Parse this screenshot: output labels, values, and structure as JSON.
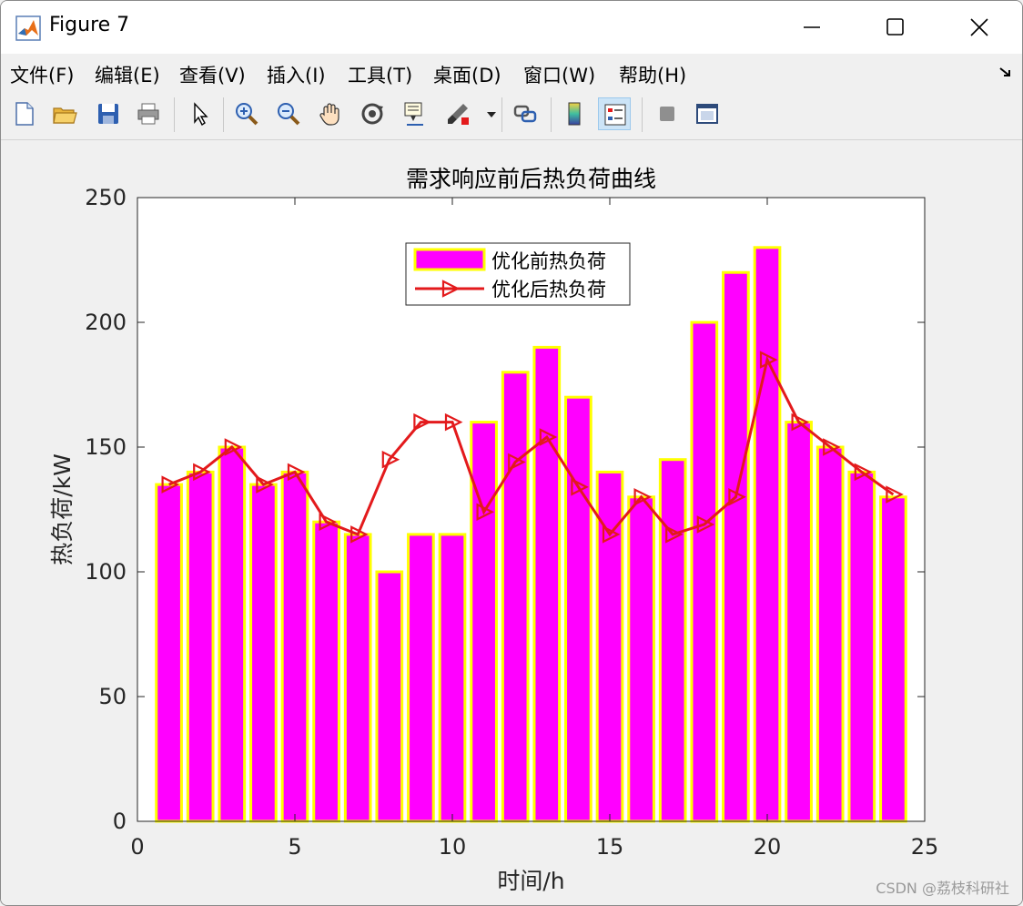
{
  "window": {
    "title": "Figure 7"
  },
  "menu": [
    "文件(F)",
    "编辑(E)",
    "查看(V)",
    "插入(I)",
    "工具(T)",
    "桌面(D)",
    "窗口(W)",
    "帮助(H)"
  ],
  "toolbar": {
    "icons": [
      "new-figure-icon",
      "open-file-icon",
      "save-icon",
      "print-icon",
      "pointer-icon",
      "zoom-in-icon",
      "zoom-out-icon",
      "pan-hand-icon",
      "rotate-3d-icon",
      "data-cursor-icon",
      "brush-icon",
      "link-plot-icon",
      "colorbar-icon",
      "legend-icon",
      "hide-tools-icon",
      "dock-figure-icon"
    ]
  },
  "watermark": "CSDN @荔枝科研社",
  "chart_data": {
    "type": "bar",
    "title": "需求响应前后热负荷曲线",
    "xlabel": "时间/h",
    "ylabel": "热负荷/kW",
    "xlim": [
      0,
      25
    ],
    "ylim": [
      0,
      250
    ],
    "xticks": [
      0,
      5,
      10,
      15,
      20,
      25
    ],
    "yticks": [
      0,
      50,
      100,
      150,
      200,
      250
    ],
    "legend_position": "top-center",
    "x": [
      1,
      2,
      3,
      4,
      5,
      6,
      7,
      8,
      9,
      10,
      11,
      12,
      13,
      14,
      15,
      16,
      17,
      18,
      19,
      20,
      21,
      22,
      23,
      24
    ],
    "series": [
      {
        "name": "优化前热负荷",
        "type": "bar",
        "fill": "#ff00ff",
        "edge": "#ffff00",
        "values": [
          135,
          140,
          150,
          135,
          140,
          120,
          115,
          100,
          115,
          115,
          160,
          180,
          190,
          170,
          140,
          130,
          145,
          200,
          220,
          230,
          160,
          150,
          140,
          130
        ]
      },
      {
        "name": "优化后热负荷",
        "type": "line",
        "color": "#e31a1c",
        "marker": "triangle-right",
        "values": [
          135,
          140,
          150,
          135,
          140,
          120,
          115,
          145,
          160,
          160,
          124,
          144,
          154,
          134,
          115,
          130,
          115,
          119,
          130,
          185,
          160,
          150,
          140,
          131
        ]
      }
    ]
  }
}
